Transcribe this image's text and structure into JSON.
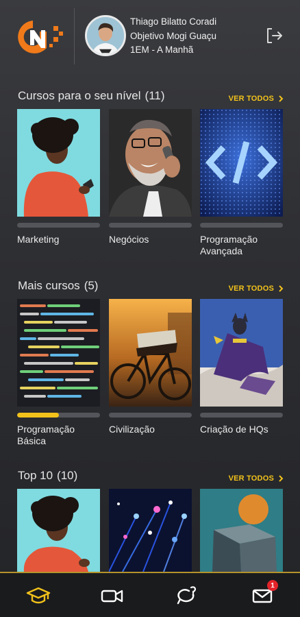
{
  "user": {
    "name": "Thiago Bilatto Coradi",
    "school": "Objetivo Mogi Guaçu",
    "class": "1EM - A Manhã"
  },
  "sections": [
    {
      "title": "Cursos para o seu nível",
      "count": "(11)",
      "see_all": "VER TODOS",
      "cards": [
        {
          "label": "Marketing",
          "progress": 0
        },
        {
          "label": "Negócios",
          "progress": 0
        },
        {
          "label": "Programação Avançada",
          "progress": 0
        }
      ]
    },
    {
      "title": "Mais cursos",
      "count": "(5)",
      "see_all": "VER TODOS",
      "cards": [
        {
          "label": "Programação Básica",
          "progress": 0.5
        },
        {
          "label": "Civilização",
          "progress": 0
        },
        {
          "label": "Criação de HQs",
          "progress": 0
        }
      ]
    },
    {
      "title": "Top 10",
      "count": "(10)",
      "see_all": "VER TODOS",
      "cards": [
        {
          "label": "",
          "progress": 0
        },
        {
          "label": "",
          "progress": 0
        },
        {
          "label": "",
          "progress": 0
        }
      ]
    }
  ],
  "bottom_nav": {
    "items": [
      "graduation-cap-icon",
      "video-camera-icon",
      "question-chat-icon",
      "mail-icon"
    ],
    "mail_badge": "1",
    "active_color": "#f2c21b"
  },
  "colors": {
    "accent": "#f2c21b",
    "background": "#2e2f33",
    "badge": "#e3232a"
  }
}
